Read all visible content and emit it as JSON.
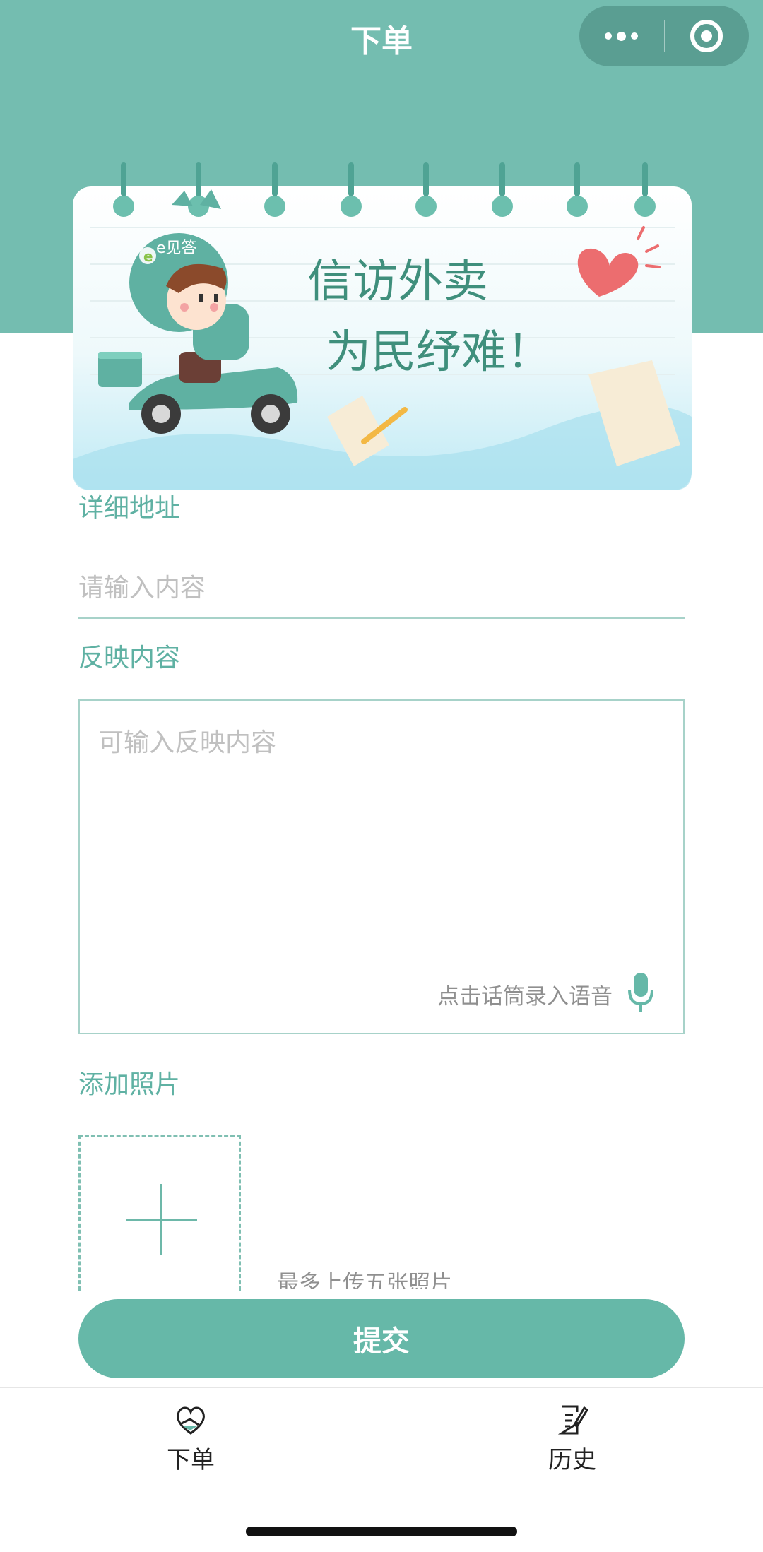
{
  "nav": {
    "title": "下单",
    "more_icon": "more-dots-icon",
    "close_icon": "target-circle-icon"
  },
  "banner": {
    "line1": "信访外卖",
    "line2": "为民纾难！",
    "badge": "e见答"
  },
  "form": {
    "address_label": "详细地址",
    "address_placeholder": "请输入内容",
    "content_label": "反映内容",
    "content_placeholder": "可输入反映内容",
    "voice_hint": "点击话筒录入语音",
    "photo_label": "添加照片",
    "photo_hint": "最多上传五张照片",
    "submit_label": "提交"
  },
  "tabbar": {
    "items": [
      {
        "label": "下单",
        "icon": "heart-hands-icon"
      },
      {
        "label": "历史",
        "icon": "document-pen-icon"
      }
    ]
  },
  "colors": {
    "accent": "#66b8a8",
    "header": "#74bdb0"
  }
}
